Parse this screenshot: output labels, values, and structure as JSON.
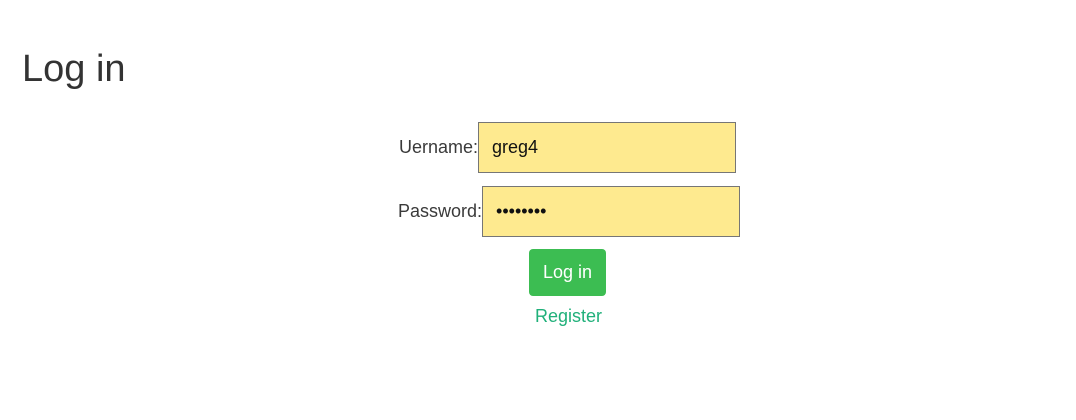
{
  "page": {
    "title": "Log in"
  },
  "form": {
    "username_label": "Uername:",
    "username_value": "greg4",
    "password_label": "Password:",
    "password_display": "••••••••",
    "login_button_label": "Log in",
    "register_link_text": "Register"
  },
  "colors": {
    "input_background": "#feea8f",
    "button_background": "#3cbd52",
    "link": "#20b07a"
  }
}
